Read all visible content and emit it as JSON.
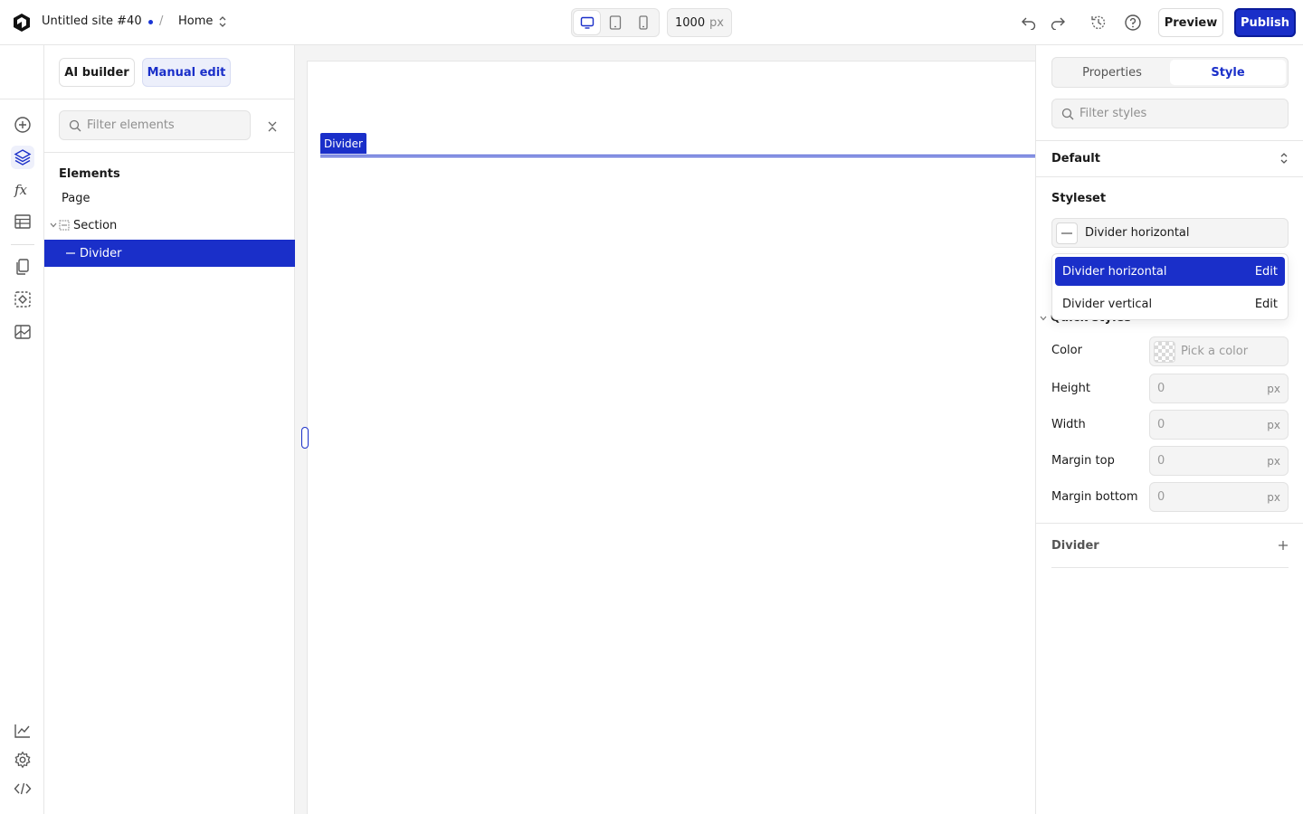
{
  "header": {
    "site_title": "Untitled site #40",
    "separator": "/",
    "page_name": "Home",
    "width_value": "1000",
    "width_unit": "px",
    "preview_label": "Preview",
    "publish_label": "Publish"
  },
  "left_panel": {
    "ai_builder_label": "AI builder",
    "manual_edit_label": "Manual edit",
    "filter_placeholder": "Filter elements",
    "elements_heading": "Elements",
    "tree": [
      {
        "label": "Page"
      },
      {
        "label": "Section"
      },
      {
        "label": "Divider"
      }
    ]
  },
  "canvas": {
    "selected_tag": "Divider"
  },
  "right_panel": {
    "tabs": [
      {
        "label": "Properties"
      },
      {
        "label": "Style"
      }
    ],
    "filter_placeholder": "Filter styles",
    "default_label": "Default",
    "styleset_heading": "Styleset",
    "styleset_selected": "Divider horizontal",
    "styleset_options": [
      {
        "label": "Divider horizontal",
        "action": "Edit"
      },
      {
        "label": "Divider vertical",
        "action": "Edit"
      }
    ],
    "quick_styles_label": "Quick styles",
    "props": {
      "color_label": "Color",
      "color_placeholder": "Pick a color",
      "height_label": "Height",
      "height_value": "0",
      "width_label": "Width",
      "width_value": "0",
      "margin_top_label": "Margin top",
      "margin_top_value": "0",
      "margin_bottom_label": "Margin bottom",
      "margin_bottom_value": "0",
      "unit": "px"
    },
    "divider_section_label": "Divider"
  },
  "colors": {
    "accent": "#1a2fc9",
    "accent_light": "#eceffb"
  },
  "icons": {
    "logo": "logo-icon",
    "devices": [
      "desktop-icon",
      "tablet-icon",
      "mobile-icon"
    ],
    "rail": [
      "add-icon",
      "layers-icon",
      "function-icon",
      "table-icon",
      "pages-icon",
      "components-icon",
      "assets-icon",
      "analytics-icon",
      "settings-icon",
      "code-icon"
    ]
  }
}
